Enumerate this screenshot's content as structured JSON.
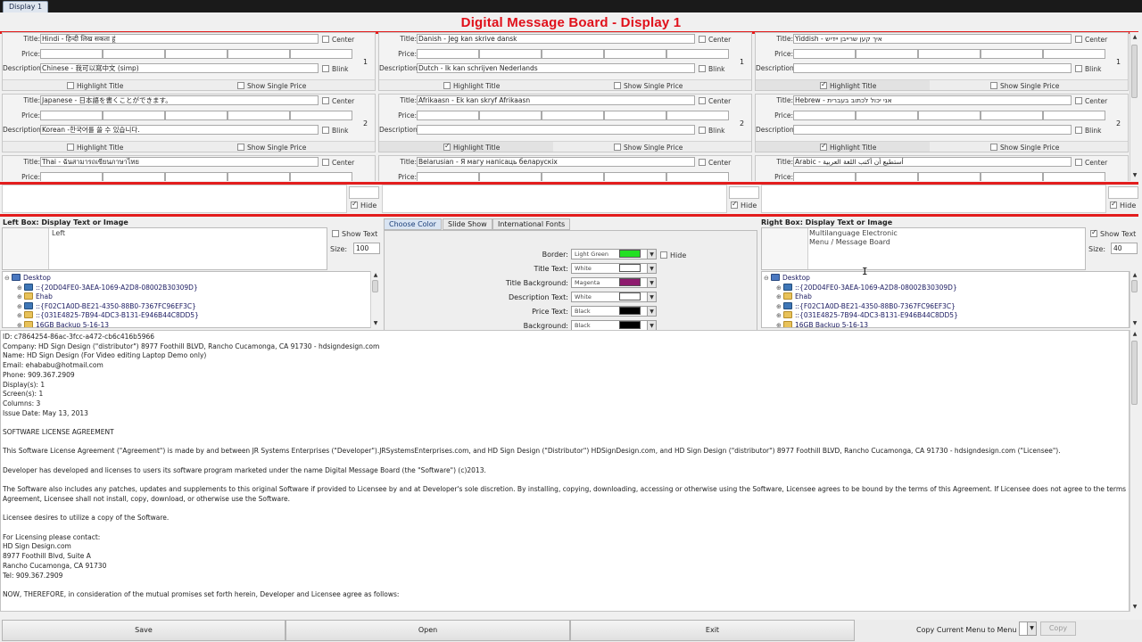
{
  "window": {
    "tab_label": "Display 1",
    "title": "Digital Message Board - Display 1"
  },
  "labels": {
    "title": "Title:",
    "price": "Price:",
    "description": "Description:",
    "center": "Center",
    "blink": "Blink",
    "highlight": "Highlight Title",
    "single_price": "Show Single Price",
    "hide": "Hide"
  },
  "cells": [
    {
      "title": "Hindi - हिन्दी लिख सकता हूं",
      "description": "Chinese - 我可以寫中文 (simp)",
      "highlight": false,
      "row": "1"
    },
    {
      "title": "Danish - Jeg kan skrive dansk",
      "description": "Dutch - Ik kan schrijven Nederlands",
      "highlight": false,
      "row": "1"
    },
    {
      "title": "Yiddish - איך קען שרייבן יידיש",
      "description": "",
      "highlight": true,
      "row": "1"
    },
    {
      "title": "Japanese - 日本語を書くことができます。",
      "description": "Korean -한국어를 쓸 수 있습니다.",
      "highlight": false,
      "row": "2"
    },
    {
      "title": "Afrikaasn - Ek kan skryf Afrikaasn",
      "description": "",
      "highlight": true,
      "row": "2"
    },
    {
      "title": "Hebrew - אני יכול לכתוב בעברית",
      "description": "",
      "highlight": true,
      "row": "2"
    },
    {
      "title": "Thai - ฉันสามารถเขียนภาษาไทย",
      "description": "",
      "highlight": false,
      "row": "3"
    },
    {
      "title": "Belarusian - Я магу напісаць беларускіх",
      "description": "",
      "highlight": false,
      "row": "3"
    },
    {
      "title": "Arabic - أستطيع أن أكتب اللغة العربية",
      "description": "",
      "highlight": false,
      "row": "3"
    }
  ],
  "preview_hide": [
    "Hide",
    "Hide",
    "Hide"
  ],
  "left_box": {
    "title": "Left Box: Display Text or Image",
    "text": "Left",
    "show_text": "Show Text",
    "size_label": "Size:",
    "size": "100"
  },
  "right_box": {
    "title": "Right Box: Display Text or Image",
    "text_line1": "Multilanguage Electronic",
    "text_line2": "Menu / Message Board",
    "show_text": "Show Text",
    "size_label": "Size:",
    "size": "40"
  },
  "tree": {
    "items": [
      "Desktop",
      "::{20D04FE0-3AEA-1069-A2D8-08002B30309D}",
      "Ehab",
      "::{F02C1A0D-BE21-4350-88B0-7367FC96EF3C}",
      "::{031E4825-7B94-4DC3-B131-E946B44C8DD5}",
      "16GB Backup 5-16-13"
    ]
  },
  "color_tabs": [
    "Choose Color",
    "Slide Show",
    "International Fonts"
  ],
  "colors": [
    {
      "label": "Border:",
      "value": "Light Green",
      "swatch": "#22e022",
      "hide": "Hide"
    },
    {
      "label": "Title Text:",
      "value": "White",
      "swatch": "#ffffff"
    },
    {
      "label": "Title Background:",
      "value": "Magenta",
      "swatch": "#8e1a6e"
    },
    {
      "label": "Description Text:",
      "value": "White",
      "swatch": "#ffffff"
    },
    {
      "label": "Price Text:",
      "value": "Black",
      "swatch": "#000000"
    },
    {
      "label": "Background:",
      "value": "Black",
      "swatch": "#000000"
    }
  ],
  "license": [
    "ID: c7864254-86ac-3fcc-a472-cb6c416b5966",
    "Company: HD Sign Design (\"distributor\") 8977 Foothill BLVD, Rancho Cucamonga, CA 91730 - hdsigndesign.com",
    "Name: HD Sign Design (For Video editing Laptop Demo only)",
    "Email: ehababu@hotmail.com",
    "Phone: 909.367.2909",
    "Display(s): 1",
    "Screen(s): 1",
    "Columns: 3",
    "Issue Date: May 13, 2013",
    "",
    "SOFTWARE LICENSE AGREEMENT",
    "",
    "This Software License Agreement (\"Agreement\") is made by and between JR Systems Enterprises (\"Developer\").JRSystemsEnterprises.com, and HD Sign Design (\"Distributor\") HDSignDesign.com, and HD Sign Design (\"distributor\") 8977 Foothill BLVD, Rancho Cucamonga, CA 91730 - hdsigndesign.com (\"Licensee\").",
    "",
    "Developer has developed and licenses to users its software program marketed under the name Digital Message Board (the \"Software\") (c)2013.",
    "",
    "The Software also includes any patches, updates and supplements to this original Software if provided to Licensee by and at Developer's sole discretion. By installing, copying, downloading, accessing or otherwise using the Software, Licensee agrees to be bound by the terms of this Agreement. If Licensee does not agree to the terms of this",
    "Agreement, Licensee shall not install, copy, download, or otherwise use the Software.",
    "",
    "Licensee desires to utilize a copy of the Software.",
    "",
    "For Licensing please contact:",
    "HD Sign Design.com",
    "8977 Foothill Blvd, Suite A",
    "Rancho Cucamonga, CA 91730",
    "Tel: 909.367.2909",
    "",
    "NOW, THEREFORE, in consideration of the mutual promises set forth herein, Developer and Licensee agree as follows:"
  ],
  "bottom": {
    "save": "Save",
    "open": "Open",
    "exit": "Exit",
    "copy_label": "Copy Current Menu to Menu #",
    "copy_button": "Copy"
  }
}
